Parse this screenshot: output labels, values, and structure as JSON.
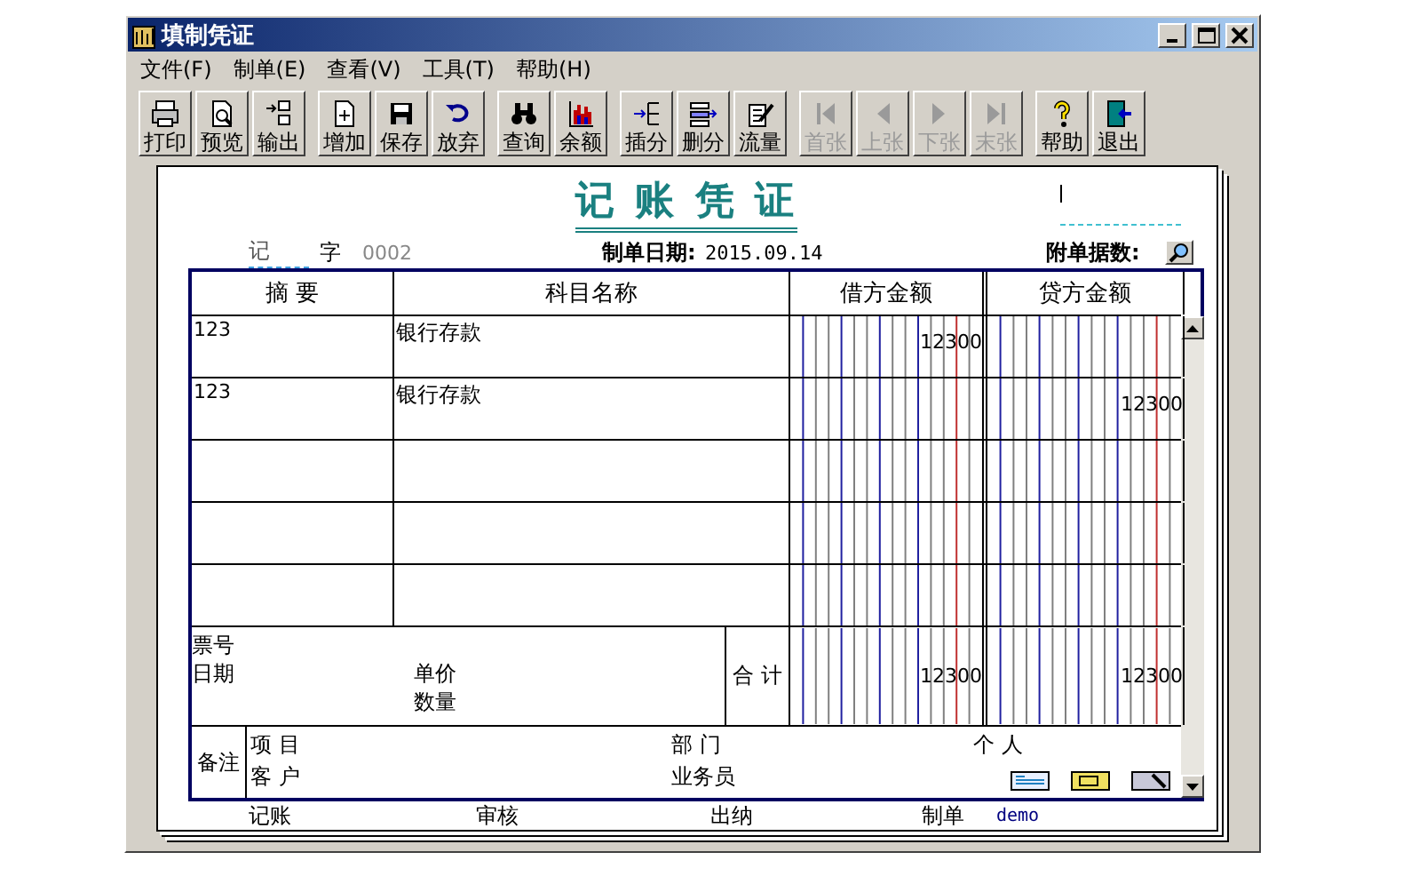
{
  "window": {
    "title": "填制凭证"
  },
  "menu": [
    "文件(F)",
    "制单(E)",
    "查看(V)",
    "工具(T)",
    "帮助(H)"
  ],
  "toolbar": [
    [
      {
        "label": "打印",
        "disabled": false
      },
      {
        "label": "预览",
        "disabled": false
      },
      {
        "label": "输出",
        "disabled": false
      }
    ],
    [
      {
        "label": "增加",
        "disabled": false
      },
      {
        "label": "保存",
        "disabled": false
      },
      {
        "label": "放弃",
        "disabled": false
      }
    ],
    [
      {
        "label": "查询",
        "disabled": false
      },
      {
        "label": "余额",
        "disabled": false
      }
    ],
    [
      {
        "label": "插分",
        "disabled": false
      },
      {
        "label": "删分",
        "disabled": false
      },
      {
        "label": "流量",
        "disabled": false
      }
    ],
    [
      {
        "label": "首张",
        "disabled": true
      },
      {
        "label": "上张",
        "disabled": true
      },
      {
        "label": "下张",
        "disabled": true
      },
      {
        "label": "末张",
        "disabled": true
      }
    ],
    [
      {
        "label": "帮助",
        "disabled": false
      },
      {
        "label": "退出",
        "disabled": false
      }
    ]
  ],
  "voucher": {
    "title": "记 账 凭 证",
    "type": "记",
    "type_suffix": "字",
    "number": "0002",
    "date_label": "制单日期:",
    "date": "2015.09.14",
    "attachments_label": "附单据数:",
    "columns": [
      "摘 要",
      "科目名称",
      "借方金额",
      "贷方金额"
    ],
    "rows": [
      {
        "summary": "123",
        "account": "银行存款",
        "debit": "12300"
      },
      {
        "summary": "123",
        "account": "银行存款",
        "credit": "12300"
      },
      {},
      {},
      {}
    ],
    "details": {
      "ticket_label": "票号",
      "date_label": "日期",
      "price_label": "单价",
      "quantity_label": "数量",
      "total_label": "合 计",
      "total_debit": "12300",
      "total_credit": "12300"
    },
    "remarks": {
      "label": "备注",
      "project_label": "项 目",
      "customer_label": "客 户",
      "department_label": "部 门",
      "salesperson_label": "业务员",
      "person_label": "个 人"
    },
    "signatures": {
      "bookkeeping_label": "记账",
      "review_label": "审核",
      "cashier_label": "出纳",
      "maker_label": "制单",
      "maker": "demo"
    }
  }
}
